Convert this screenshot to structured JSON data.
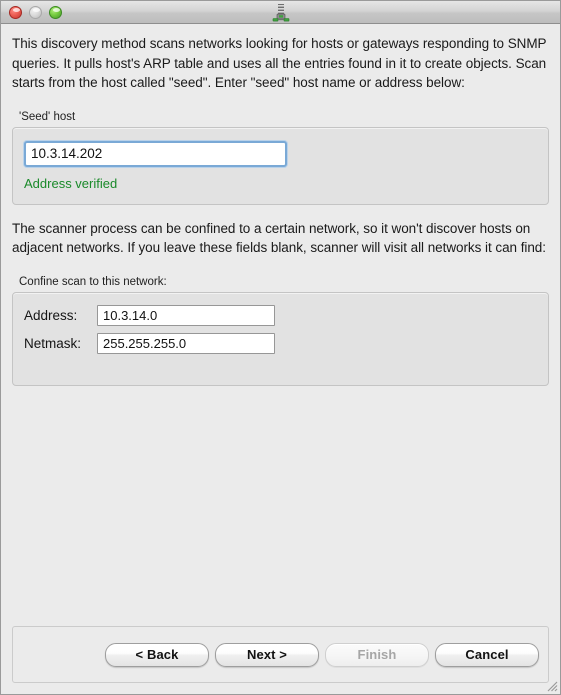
{
  "window": {
    "titlebar": {
      "close_label": "close",
      "minimize_label": "minimize",
      "zoom_label": "zoom",
      "icon_name": "firewall-host-icon"
    }
  },
  "intro": {
    "paragraph1": "This discovery method scans networks looking for hosts or gateways responding to SNMP queries. It pulls host's ARP table and uses all the entries found in it to create objects. Scan starts from the host called \"seed\". Enter \"seed\" host name or address below:",
    "paragraph2": "The scanner process can be confined to a certain network, so it won't discover hosts on adjacent networks. If you leave these fields blank, scanner will visit all networks it can find:"
  },
  "seed_group": {
    "title": "'Seed' host",
    "host_value": "10.3.14.202",
    "host_placeholder": "",
    "status_text": "Address verified",
    "status_color": "#1a8a2a"
  },
  "confine_group": {
    "title": "Confine scan to this network:",
    "address_label": "Address:",
    "address_value": "10.3.14.0",
    "address_placeholder": "",
    "netmask_label": "Netmask:",
    "netmask_value": "255.255.255.0",
    "netmask_placeholder": ""
  },
  "buttons": {
    "back": "< Back",
    "next": "Next >",
    "finish": "Finish",
    "cancel": "Cancel",
    "finish_enabled": false
  }
}
